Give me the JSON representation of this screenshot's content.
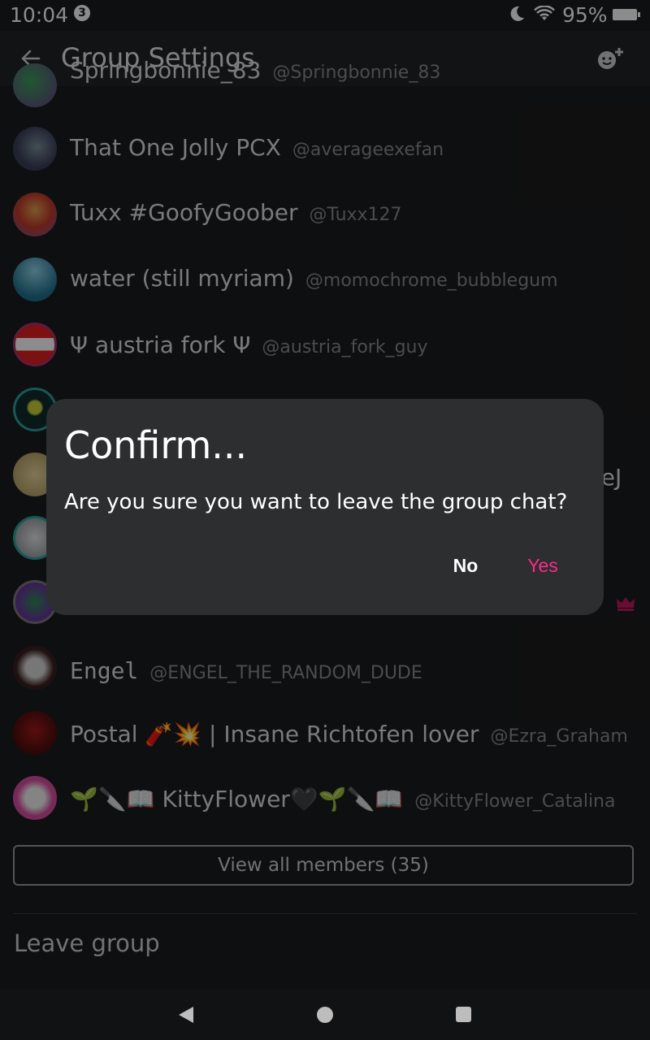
{
  "status_bar": {
    "time": "10:04",
    "notification_count": "3",
    "battery": "95%"
  },
  "header": {
    "title": "Group Settings",
    "back_icon": "back-arrow-icon",
    "action_icon": "add-member-icon"
  },
  "members": [
    {
      "name": "Springbonnie_83",
      "handle": "@Springbonnie_83",
      "avatar_colors": [
        "#6a3a8a",
        "#3aa05a"
      ]
    },
    {
      "name": "That One Jolly PCX",
      "handle": "@averageexefan",
      "avatar_colors": [
        "#3b3f5a",
        "#7a8f9a"
      ]
    },
    {
      "name": "Tuxx #GoofyGoober",
      "handle": "@Tuxx127",
      "avatar_colors": [
        "#c0392b",
        "#6b5b95"
      ]
    },
    {
      "name": "water (still myriam)",
      "handle": "@momochrome_bubblegum",
      "avatar_colors": [
        "#1f6f8b",
        "#8fd3e8"
      ]
    },
    {
      "name": "Ψ austria fork Ψ",
      "handle": "@austria_fork_guy",
      "avatar_colors": [
        "#e02020",
        "#ffffff"
      ]
    },
    {
      "name": "",
      "handle": "",
      "avatar_colors": [
        "#0f2b2b",
        "#c7d23a"
      ]
    },
    {
      "name": "",
      "handle": "",
      "avatar_colors": [
        "#b8a36a",
        "#e8d79a"
      ]
    },
    {
      "name": "",
      "handle": "",
      "avatar_colors": [
        "#e6e6e6",
        "#9aa0a6"
      ]
    },
    {
      "name": "",
      "handle": "",
      "avatar_colors": [
        "#6b2fa0",
        "#2e8b57"
      ],
      "crown": true
    },
    {
      "name": "Engel",
      "handle": "@ENGEL_THE_RANDOM_DUDE",
      "avatar_colors": [
        "#3a1f1f",
        "#d9d9d9"
      ]
    },
    {
      "name": "Postal 🧨💥 | Insane Richtofen lover",
      "handle": "@Ezra_Graham",
      "avatar_colors": [
        "#4a0d0d",
        "#a01a1a"
      ]
    },
    {
      "name": "🌱🔪📖      KittyFlower🖤🌱🔪📖",
      "handle": "@KittyFlower_Catalina",
      "avatar_colors": [
        "#d64da0",
        "#f0f0f0"
      ]
    }
  ],
  "partial_name_fragment": "neJ",
  "view_all_label": "View all members (35)",
  "leave_label": "Leave group",
  "dialog": {
    "title": "Confirm...",
    "message": "Are you sure you want to leave the group chat?",
    "no_label": "No",
    "yes_label": "Yes",
    "yes_color": "#ff2a8a"
  },
  "colors": {
    "background": "#1b1c1e",
    "dialog_bg": "#2c2e2f",
    "crown": "#c2185b"
  }
}
